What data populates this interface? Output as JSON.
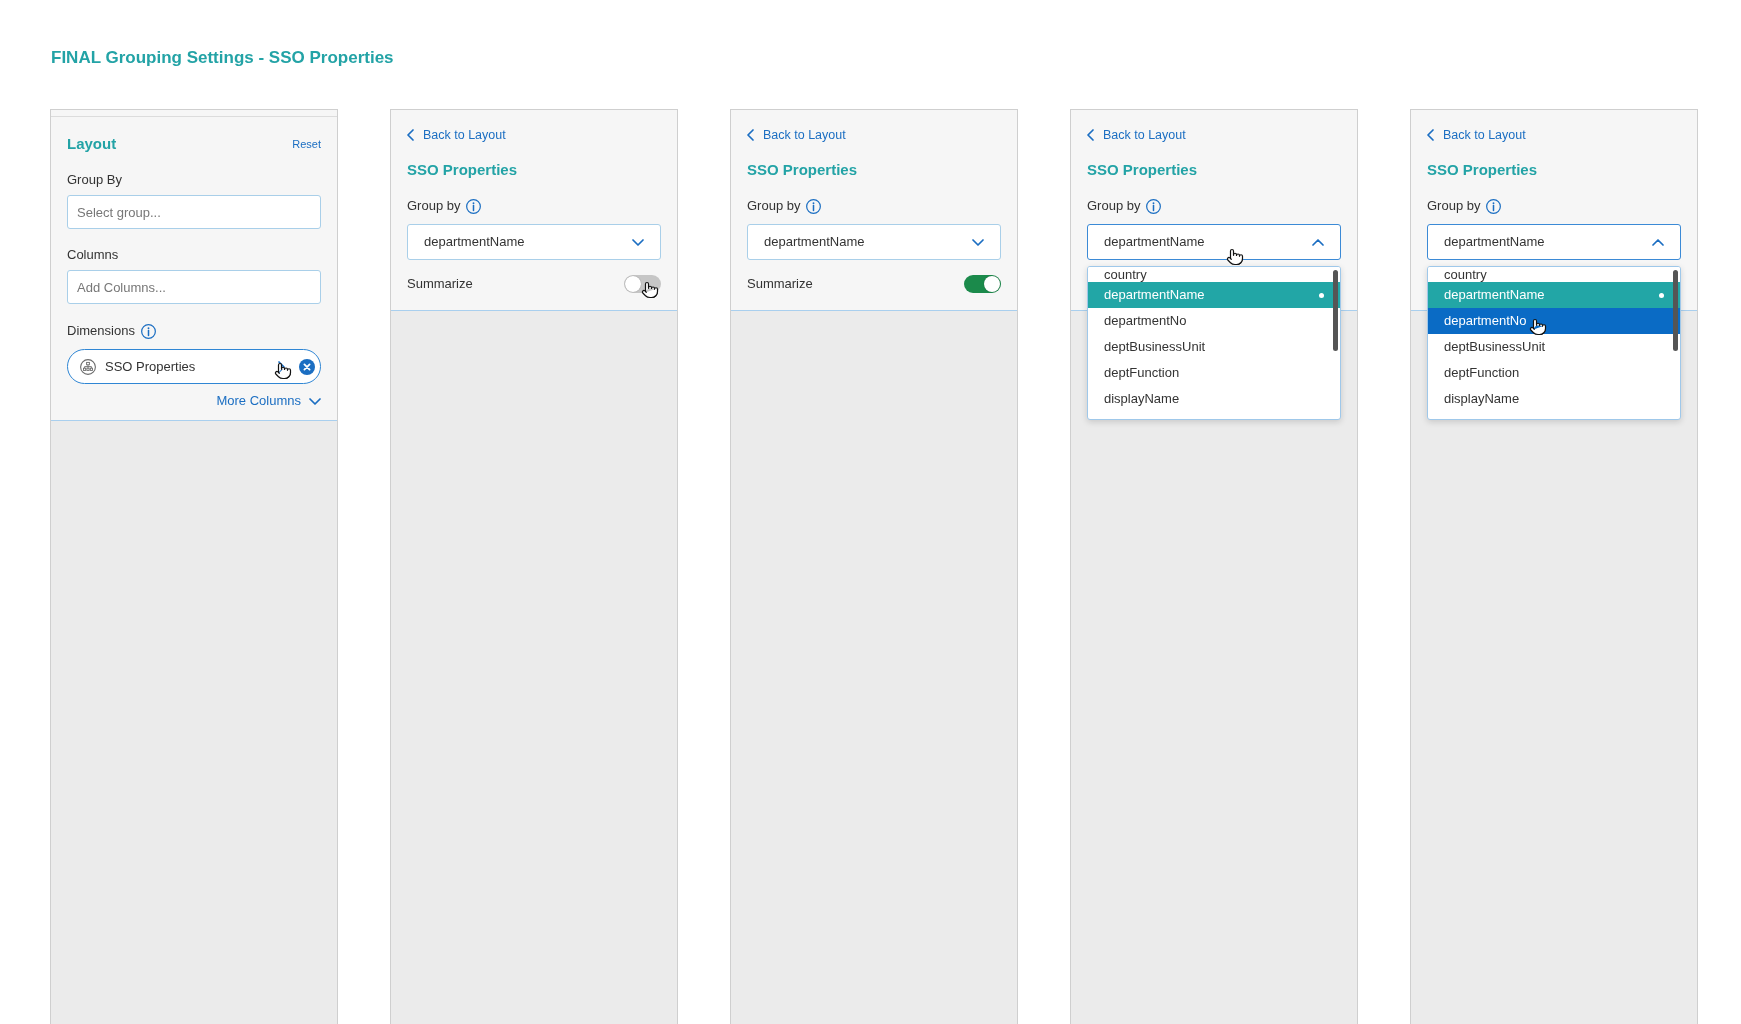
{
  "title": "FINAL Grouping Settings - SSO Properties",
  "panels": [
    {
      "kind": "layout",
      "heading": "Layout",
      "reset": "Reset",
      "fields": [
        {
          "label": "Group By",
          "placeholder": "Select group..."
        },
        {
          "label": "Columns",
          "placeholder": "Add Columns..."
        }
      ],
      "dimensions": {
        "label": "Dimensions",
        "items": [
          {
            "label": "SSO Properties",
            "hovered": true
          }
        ]
      },
      "more": "More Columns"
    },
    {
      "kind": "properties",
      "back": "Back to Layout",
      "heading": "SSO Properties",
      "group_by": {
        "label": "Group by",
        "value": "departmentName",
        "expanded": false,
        "hovered": false
      },
      "summarize": {
        "label": "Summarize",
        "on": false,
        "hovered": true
      }
    },
    {
      "kind": "properties",
      "back": "Back to Layout",
      "heading": "SSO Properties",
      "group_by": {
        "label": "Group by",
        "value": "departmentName",
        "expanded": false,
        "hovered": false
      },
      "summarize": {
        "label": "Summarize",
        "on": true,
        "hovered": false
      }
    },
    {
      "kind": "properties",
      "back": "Back to Layout",
      "heading": "SSO Properties",
      "group_by": {
        "label": "Group by",
        "value": "departmentName",
        "expanded": true,
        "hovered": true,
        "options": [
          {
            "label": "country",
            "selected": false,
            "hovered": false
          },
          {
            "label": "departmentName",
            "selected": true,
            "hovered": false
          },
          {
            "label": "departmentNo",
            "selected": false,
            "hovered": false
          },
          {
            "label": "deptBusinessUnit",
            "selected": false,
            "hovered": false
          },
          {
            "label": "deptFunction",
            "selected": false,
            "hovered": false
          },
          {
            "label": "displayName",
            "selected": false,
            "hovered": false
          }
        ]
      }
    },
    {
      "kind": "properties",
      "back": "Back to Layout",
      "heading": "SSO Properties",
      "group_by": {
        "label": "Group by",
        "value": "departmentName",
        "expanded": true,
        "hovered": false,
        "options": [
          {
            "label": "country",
            "selected": false,
            "hovered": false
          },
          {
            "label": "departmentName",
            "selected": true,
            "hovered": false
          },
          {
            "label": "departmentNo",
            "selected": false,
            "hovered": true
          },
          {
            "label": "deptBusinessUnit",
            "selected": false,
            "hovered": false
          },
          {
            "label": "deptFunction",
            "selected": false,
            "hovered": false
          },
          {
            "label": "displayName",
            "selected": false,
            "hovered": false
          }
        ]
      }
    }
  ]
}
